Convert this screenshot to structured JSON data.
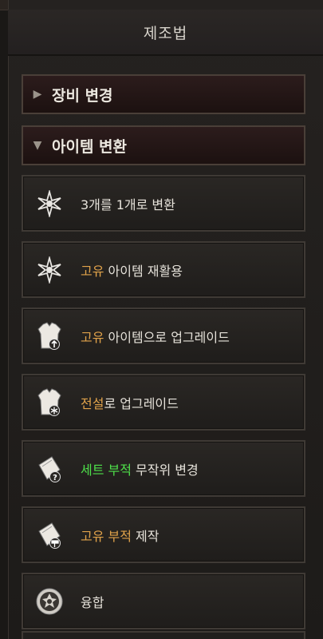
{
  "title": "제조법",
  "sections": [
    {
      "label": "장비 변경",
      "expanded": false
    },
    {
      "label": "아이템 변환",
      "expanded": true
    }
  ],
  "recipes": [
    {
      "icon": "star-icon",
      "parts": [
        {
          "text": "3개를 1개로 변환",
          "color": "default"
        }
      ]
    },
    {
      "icon": "star-icon",
      "parts": [
        {
          "text": "고유",
          "color": "orange"
        },
        {
          "text": " 아이템 재활용",
          "color": "default"
        }
      ]
    },
    {
      "icon": "armor-upgrade-icon",
      "parts": [
        {
          "text": "고유",
          "color": "orange"
        },
        {
          "text": " 아이템으로 업그레이드",
          "color": "default"
        }
      ]
    },
    {
      "icon": "armor-snowflake-icon",
      "parts": [
        {
          "text": "전설",
          "color": "orange"
        },
        {
          "text": "로 업그레이드",
          "color": "default"
        }
      ]
    },
    {
      "icon": "charm-question-icon",
      "parts": [
        {
          "text": "세트 부적",
          "color": "green"
        },
        {
          "text": " 무작위 변경",
          "color": "default"
        }
      ]
    },
    {
      "icon": "charm-hammer-icon",
      "parts": [
        {
          "text": "고유 부적",
          "color": "orange"
        },
        {
          "text": " 제작",
          "color": "default"
        }
      ]
    },
    {
      "icon": "fusion-icon",
      "parts": [
        {
          "text": "융합",
          "color": "default"
        }
      ]
    }
  ],
  "colors": {
    "orange": "#e0a24a",
    "green": "#4ee04a",
    "default": "#e6e2da"
  }
}
